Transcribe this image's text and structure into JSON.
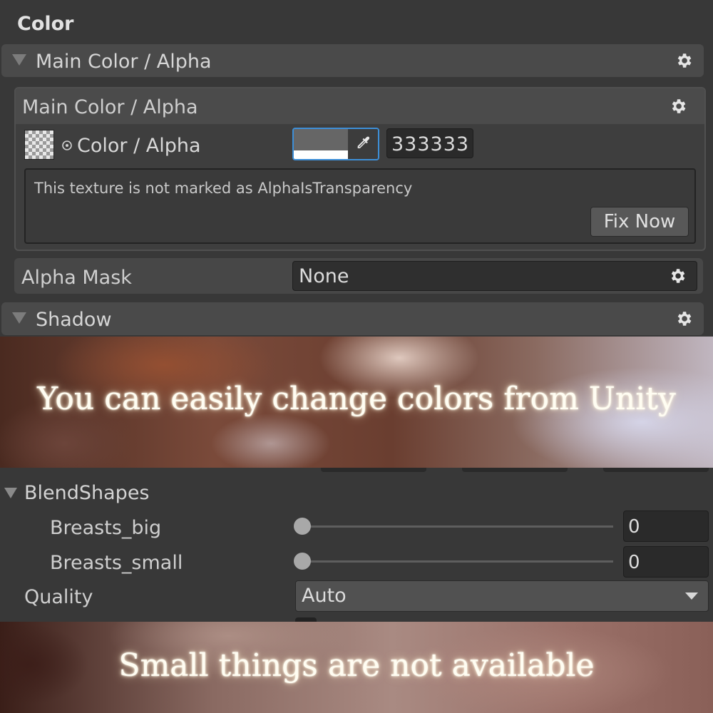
{
  "color_section": {
    "title": "Color",
    "main_foldout_label": "Main Color / Alpha",
    "panel": {
      "header_label": "Main Color / Alpha",
      "property_label": "Color / Alpha",
      "hex_value": "333333",
      "helpbox_message": "This texture is not marked as AlphaIsTransparency",
      "fix_button_label": "Fix Now"
    },
    "alpha_mask": {
      "label": "Alpha Mask",
      "value": "None"
    },
    "shadow_foldout_label": "Shadow"
  },
  "banner_top": {
    "caption": "You can easily change colors from Unity"
  },
  "blendshapes": {
    "header_label": "BlendShapes",
    "items": [
      {
        "label": "Breasts_big",
        "value": "0"
      },
      {
        "label": "Breasts_small",
        "value": "0"
      }
    ]
  },
  "quality": {
    "label": "Quality",
    "value": "Auto"
  },
  "banner_bottom": {
    "caption": "Small things are not available"
  },
  "colors": {
    "editor_background": "#383838",
    "foldout_background": "#4a4a4a",
    "focus_outline": "#3d8fd8"
  }
}
